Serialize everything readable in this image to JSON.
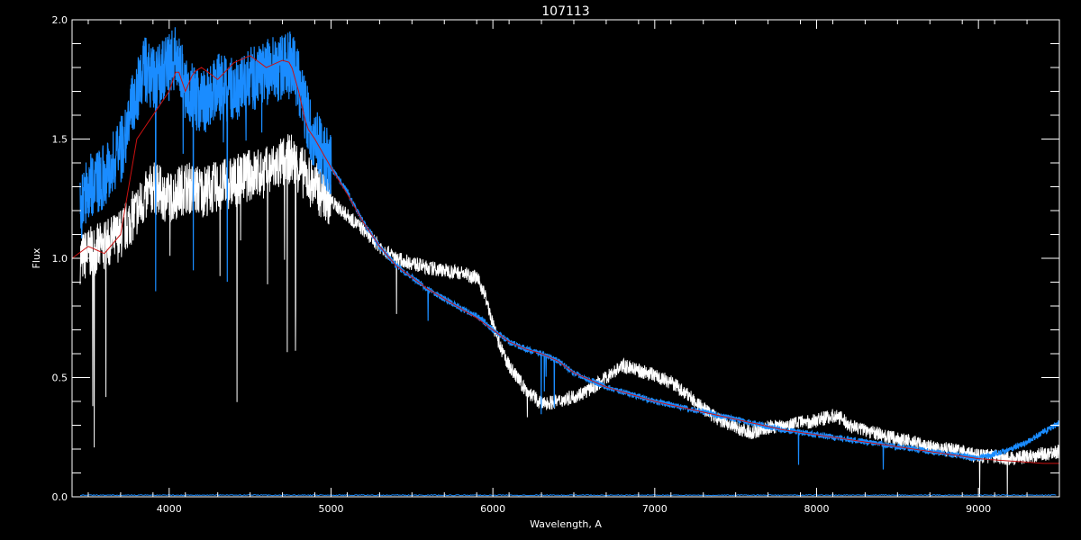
{
  "chart_data": {
    "type": "line",
    "title": "107113",
    "xlabel": "Wavelength, A",
    "ylabel": "Flux",
    "xlim": [
      3400,
      9500
    ],
    "ylim": [
      0,
      2.0
    ],
    "xticks": [
      4000,
      5000,
      6000,
      7000,
      8000,
      9000
    ],
    "yticks": [
      0.0,
      0.5,
      1.0,
      1.5,
      2.0
    ],
    "ytick_labels": [
      "0.0",
      "0.5",
      "1.0",
      "1.5",
      "2.0"
    ],
    "grid": false,
    "legend": "none",
    "series": [
      {
        "color": "#ffffff",
        "x": [
          3450,
          3500,
          3600,
          3700,
          3800,
          3900,
          4000,
          4100,
          4200,
          4300,
          4400,
          4500,
          4600,
          4700,
          4750,
          4800,
          4900,
          5000,
          5100,
          5200,
          5300,
          5400,
          5500,
          5600,
          5700,
          5800,
          5900,
          5950,
          6000,
          6050,
          6100,
          6200,
          6300,
          6400,
          6500,
          6600,
          6700,
          6800,
          6900,
          7000,
          7100,
          7200,
          7300,
          7400,
          7500,
          7600,
          7700,
          7800,
          7900,
          8000,
          8100,
          8150,
          8200,
          8300,
          8400,
          8500,
          8600,
          8700,
          8800,
          8900,
          9000,
          9100,
          9200,
          9300,
          9400,
          9500
        ],
        "y": [
          1.0,
          1.02,
          1.05,
          1.1,
          1.2,
          1.3,
          1.25,
          1.3,
          1.28,
          1.3,
          1.32,
          1.35,
          1.36,
          1.4,
          1.42,
          1.38,
          1.3,
          1.24,
          1.18,
          1.12,
          1.05,
          1.0,
          0.98,
          0.96,
          0.95,
          0.94,
          0.92,
          0.85,
          0.72,
          0.62,
          0.55,
          0.45,
          0.39,
          0.4,
          0.42,
          0.45,
          0.5,
          0.55,
          0.53,
          0.51,
          0.48,
          0.43,
          0.37,
          0.32,
          0.29,
          0.27,
          0.29,
          0.3,
          0.31,
          0.32,
          0.34,
          0.33,
          0.3,
          0.28,
          0.26,
          0.24,
          0.23,
          0.21,
          0.2,
          0.19,
          0.17,
          0.17,
          0.16,
          0.17,
          0.18,
          0.19
        ]
      },
      {
        "color": "#1a8cff",
        "x": [
          3450,
          3500,
          3600,
          3700,
          3800,
          3850,
          3900,
          4000,
          4050,
          4100,
          4200,
          4300,
          4400,
          4500,
          4600,
          4700,
          4750,
          4800,
          4850,
          4900,
          5000,
          5100,
          5200,
          5300,
          5400,
          5500,
          5600,
          5700,
          5800,
          5900,
          6000,
          6100,
          6200,
          6300,
          6400,
          6500,
          6600,
          6700,
          6800,
          6900,
          7000,
          7200,
          7400,
          7600,
          7800,
          8000,
          8200,
          8400,
          8600,
          8800,
          9000,
          9100,
          9200,
          9300,
          9400,
          9500
        ],
        "y": [
          1.2,
          1.3,
          1.35,
          1.45,
          1.7,
          1.8,
          1.75,
          1.8,
          1.85,
          1.7,
          1.65,
          1.72,
          1.7,
          1.75,
          1.78,
          1.8,
          1.83,
          1.75,
          1.6,
          1.5,
          1.38,
          1.28,
          1.15,
          1.05,
          0.97,
          0.92,
          0.87,
          0.83,
          0.79,
          0.76,
          0.7,
          0.65,
          0.62,
          0.6,
          0.57,
          0.52,
          0.49,
          0.46,
          0.44,
          0.42,
          0.4,
          0.37,
          0.34,
          0.31,
          0.28,
          0.26,
          0.24,
          0.22,
          0.2,
          0.18,
          0.16,
          0.18,
          0.2,
          0.23,
          0.27,
          0.31
        ]
      },
      {
        "color": "#cc1111",
        "x": [
          3400,
          3500,
          3600,
          3700,
          3800,
          3900,
          4000,
          4050,
          4100,
          4150,
          4200,
          4300,
          4400,
          4500,
          4600,
          4700,
          4750,
          4800,
          4850,
          4900,
          5000,
          5100,
          5200,
          5300,
          5400,
          5500,
          5600,
          5700,
          5800,
          5900,
          6000,
          6100,
          6200,
          6300,
          6400,
          6500,
          6600,
          6700,
          6800,
          6900,
          7000,
          7200,
          7400,
          7600,
          7800,
          8000,
          8200,
          8400,
          8600,
          8800,
          9000,
          9200,
          9400,
          9500
        ],
        "y": [
          1.0,
          1.05,
          1.02,
          1.1,
          1.5,
          1.6,
          1.7,
          1.8,
          1.7,
          1.78,
          1.8,
          1.75,
          1.82,
          1.85,
          1.8,
          1.83,
          1.82,
          1.7,
          1.55,
          1.5,
          1.38,
          1.27,
          1.15,
          1.05,
          0.97,
          0.92,
          0.87,
          0.83,
          0.79,
          0.75,
          0.7,
          0.65,
          0.62,
          0.6,
          0.57,
          0.52,
          0.49,
          0.46,
          0.44,
          0.42,
          0.4,
          0.37,
          0.34,
          0.31,
          0.28,
          0.26,
          0.24,
          0.22,
          0.2,
          0.18,
          0.16,
          0.15,
          0.14,
          0.14
        ]
      }
    ]
  }
}
